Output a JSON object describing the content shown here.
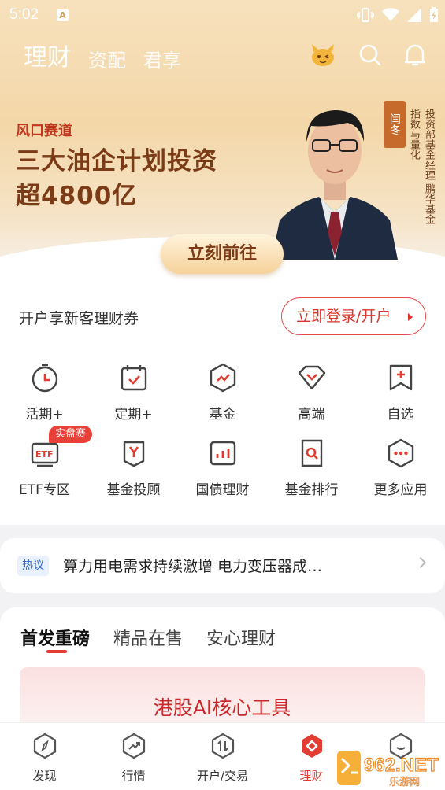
{
  "status_bar": {
    "time": "5:02",
    "notification_badge": "A"
  },
  "top_nav": {
    "tabs": [
      "理财",
      "资配",
      "君享"
    ],
    "active_tab": "理财"
  },
  "banner": {
    "tag": "风口赛道",
    "title_line1": "三大油企计划投资",
    "title_line2": "超4800亿",
    "person_name": "闫冬",
    "person_desc_line1": "投资部基金经理",
    "person_desc_line2": "鹏华基金指数与量化",
    "cta": "立刻前往"
  },
  "promo": {
    "text": "开户享新客理财券",
    "login_button": "立即登录/开户"
  },
  "quick_grid": [
    {
      "label": "活期+",
      "icon": "stopwatch-icon"
    },
    {
      "label": "定期+",
      "icon": "calendar-icon"
    },
    {
      "label": "基金",
      "icon": "hexagon-chart-icon"
    },
    {
      "label": "高端",
      "icon": "diamond-icon"
    },
    {
      "label": "自选",
      "icon": "add-bookmark-icon"
    },
    {
      "label": "ETF专区",
      "icon": "etf-icon",
      "badge": "实盘赛"
    },
    {
      "label": "基金投顾",
      "icon": "advisor-icon"
    },
    {
      "label": "国债理财",
      "icon": "bond-icon"
    },
    {
      "label": "基金排行",
      "icon": "ranking-icon"
    },
    {
      "label": "更多应用",
      "icon": "more-apps-icon"
    }
  ],
  "hot": {
    "tag": "热议",
    "text": "算力用电需求持续激增 电力变压器成…"
  },
  "section": {
    "tabs": [
      "首发重磅",
      "精品在售",
      "安心理财"
    ],
    "active_tab": "首发重磅",
    "card_title": "港股AI核心工具"
  },
  "bottom_nav": [
    {
      "label": "发现",
      "icon": "compass-icon"
    },
    {
      "label": "行情",
      "icon": "trend-icon"
    },
    {
      "label": "开户/交易",
      "icon": "trade-icon"
    },
    {
      "label": "理财",
      "icon": "wealth-icon",
      "active": true
    },
    {
      "label": "",
      "icon": "profile-icon"
    }
  ],
  "watermark": {
    "brand": "962.NET",
    "sub": "乐游网"
  },
  "colors": {
    "accent": "#e23d33",
    "banner_text": "#7a3b16"
  }
}
